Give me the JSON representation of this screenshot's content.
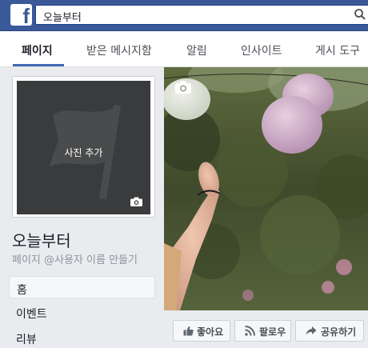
{
  "header": {
    "logo_letter": "f",
    "search_value": "오늘부터"
  },
  "tabs": [
    {
      "label": "페이지",
      "active": true
    },
    {
      "label": "받은 메시지함"
    },
    {
      "label": "알림"
    },
    {
      "label": "인사이트"
    },
    {
      "label": "게시 도구"
    }
  ],
  "profile": {
    "add_photo_label": "사진 추가",
    "page_name": "오늘부터",
    "username_prompt": "페이지 @사용자 이름 만들기"
  },
  "nav": {
    "items": [
      {
        "label": "홈",
        "selected": true
      },
      {
        "label": "이벤트"
      },
      {
        "label": "리뷰"
      }
    ]
  },
  "actions": {
    "like": "좋아요",
    "follow": "팔로우",
    "share": "공유하기"
  },
  "colors": {
    "brand_blue": "#3b5998",
    "accent": "#4267b2"
  }
}
